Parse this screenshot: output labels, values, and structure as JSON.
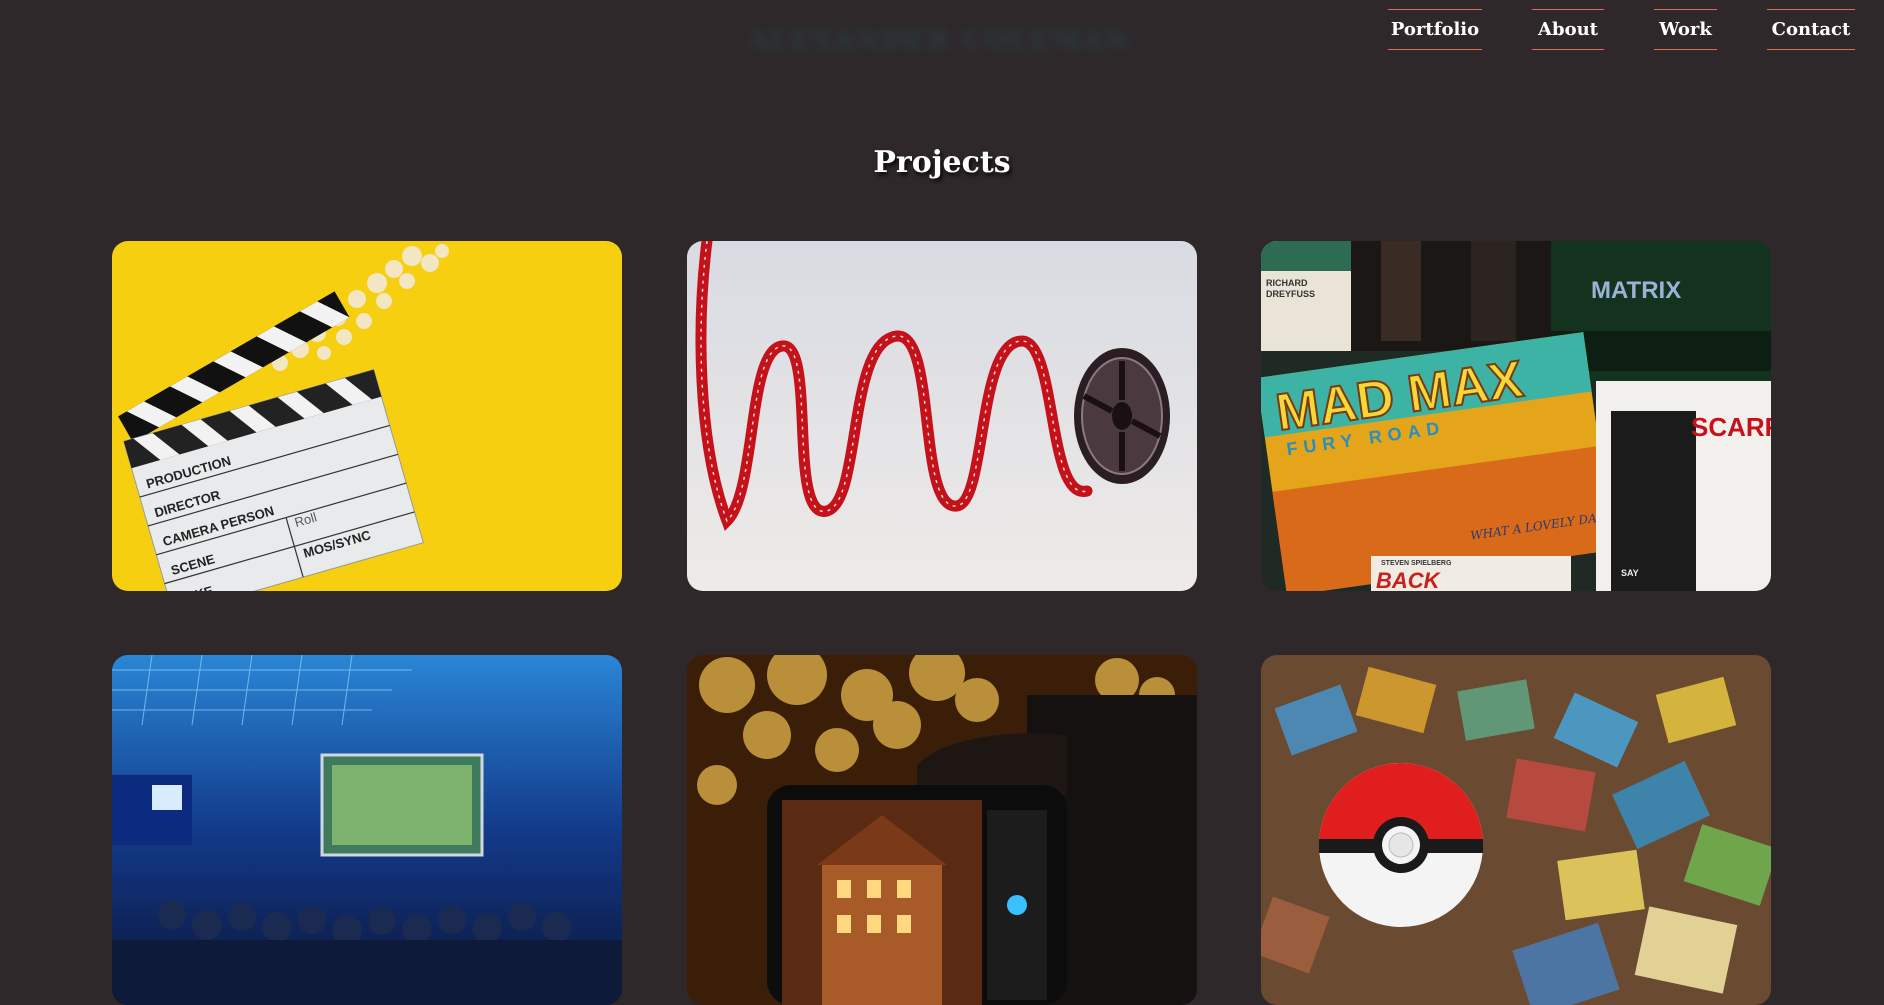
{
  "header": {
    "brand_text": "ALEXANDER COLEMAN ANDERSON"
  },
  "nav": {
    "items": [
      {
        "label": "Portfolio"
      },
      {
        "label": "About"
      },
      {
        "label": "Work"
      },
      {
        "label": "Contact"
      }
    ],
    "accent_color": "#e06b52"
  },
  "projects": {
    "title": "Projects",
    "cards": [
      {
        "icon": "clapperboard-image",
        "clapper": {
          "production": "PRODUCTION",
          "director": "DIRECTOR",
          "camera": "CAMERA PERSON",
          "scene": "SCENE",
          "roll": "Roll",
          "take": "TAKE",
          "mos": "MOS/SYNC"
        }
      },
      {
        "icon": "film-reel-image"
      },
      {
        "icon": "movie-posters-image",
        "posters": {
          "matrix": "MATRIX",
          "madmax": "MAD MAX",
          "fury": "FURY ROAD",
          "scarface": "SCARFAC",
          "lovely_day": "WHAT A LOVELY DAY.",
          "back": "BACK",
          "richard": "RICHARD",
          "dreyfuss": "DREYFUSS",
          "say": "SAY",
          "spielberg": "STEVEN SPIELBERG"
        }
      },
      {
        "icon": "presentation-hall-image"
      },
      {
        "icon": "phone-photo-image"
      },
      {
        "icon": "pokeball-cards-image"
      }
    ]
  },
  "colors": {
    "background": "#2e282a",
    "text": "#ffffff"
  }
}
